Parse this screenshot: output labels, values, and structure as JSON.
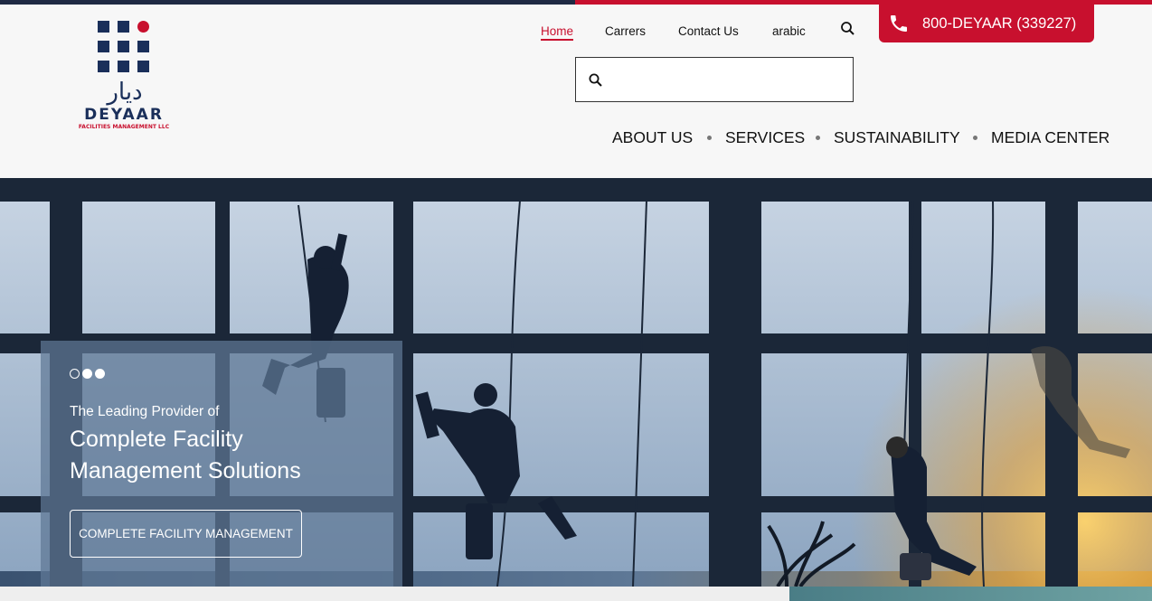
{
  "brand": {
    "arabic_name": "ديار",
    "name": "DEYAAR",
    "subtitle": "FACILITIES MANAGEMENT LLC",
    "primary_color": "#1a2f5a",
    "accent_color": "#c8102e"
  },
  "top_nav": [
    {
      "label": "Home",
      "active": true
    },
    {
      "label": "Carrers",
      "active": false
    },
    {
      "label": "Contact Us",
      "active": false
    },
    {
      "label": "arabic",
      "active": false
    }
  ],
  "phone": {
    "label": "800-DEYAAR (339227)",
    "icon": "phone-icon"
  },
  "search": {
    "placeholder": "",
    "value": "",
    "icon": "search-icon"
  },
  "main_nav": [
    {
      "label": "ABOUT US"
    },
    {
      "label": "SERVICES"
    },
    {
      "label": "SUSTAINABILITY"
    },
    {
      "label": "MEDIA CENTER"
    }
  ],
  "hero": {
    "lead": "The Leading Provider of",
    "headline_line1": "Complete Facility",
    "headline_line2": "Management Solutions",
    "cta_label": "COMPLETE FACILITY MANAGEMENT",
    "slides_total": 3,
    "active_slide": 1
  }
}
